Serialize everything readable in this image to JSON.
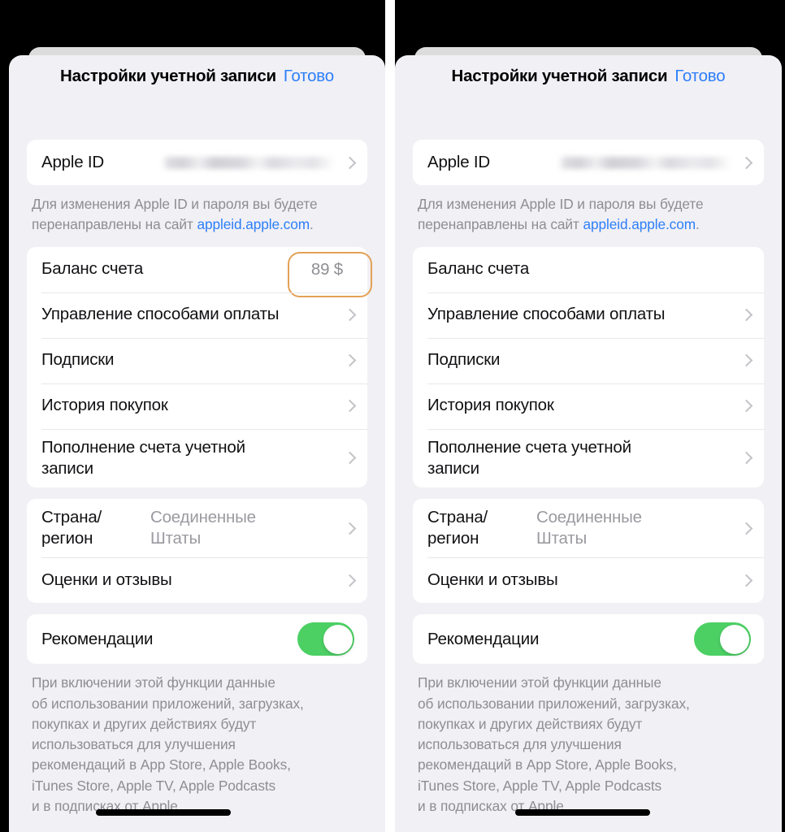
{
  "meta": {
    "description": "Two side-by-side iOS screenshots of the Apple Account Settings modal sheet in Russian. Left panel shows the account balance row with a value highlighted by an orange rounded rectangle; right panel shows the same row with no balance value.",
    "language": "ru",
    "panel_count": 2
  },
  "colors": {
    "accent_blue": "#2d7ff9",
    "highlight_orange": "#e3a155",
    "toggle_green": "#4cd064",
    "sheet_background": "#f1f0f5",
    "card_background": "#ffffff",
    "device_background": "#000000",
    "secondary_text": "#8d8d93",
    "value_text": "#9a9aa0",
    "primary_text": "#111114",
    "separator": "#e8e8ea",
    "chevron_grey": "#c2c2c7"
  },
  "header": {
    "title": "Настройки учетной записи",
    "done_label": "Готово"
  },
  "apple_id": {
    "label": "Apple ID",
    "value": "",
    "value_state": "blurred-redacted",
    "chevron": "chevron-right-icon"
  },
  "apple_id_hint": {
    "text_before": "Для изменения Apple ID и пароля вы будете\nперенаправлены на сайт ",
    "link": "appleid.apple.com",
    "text_after": "."
  },
  "account_group": {
    "rows": [
      {
        "label": "Баланс счета",
        "value": "89 $",
        "chevron": false,
        "highlighted": true
      },
      {
        "label": "Управление способами оплаты",
        "value": "",
        "chevron": true,
        "highlighted": false
      },
      {
        "label": "Подписки",
        "value": "",
        "chevron": true,
        "highlighted": false
      },
      {
        "label": "История покупок",
        "value": "",
        "chevron": true,
        "highlighted": false
      },
      {
        "label": "Пополнение счета учетной\nзаписи",
        "value": "",
        "chevron": true,
        "highlighted": false
      }
    ]
  },
  "account_group_right": {
    "rows": [
      {
        "label": "Баланс счета",
        "value": "",
        "chevron": false,
        "highlighted": false
      },
      {
        "label": "Управление способами оплаты",
        "value": "",
        "chevron": true,
        "highlighted": false
      },
      {
        "label": "Подписки",
        "value": "",
        "chevron": true,
        "highlighted": false
      },
      {
        "label": "История покупок",
        "value": "",
        "chevron": true,
        "highlighted": false
      },
      {
        "label": "Пополнение счета учетной\nзаписи",
        "value": "",
        "chevron": true,
        "highlighted": false
      }
    ]
  },
  "region_group": {
    "rows": [
      {
        "label": "Страна/\nрегион",
        "value": "Соединенные\nШтаты",
        "chevron": true
      },
      {
        "label": "Оценки и отзывы",
        "value": "",
        "chevron": true
      }
    ]
  },
  "recommendations": {
    "label": "Рекомендации",
    "toggle_state": "on",
    "toggle_name": "recommendations-toggle"
  },
  "recommendations_hint": {
    "text": "При включении этой функции данные\nоб использовании приложений, загрузках,\nпокупках и других действиях будут\nиспользоваться для улучшения\nрекомендаций в App Store, Apple Books,\niTunes Store, Apple TV, Apple Podcasts\nи в подписках от Apple."
  }
}
